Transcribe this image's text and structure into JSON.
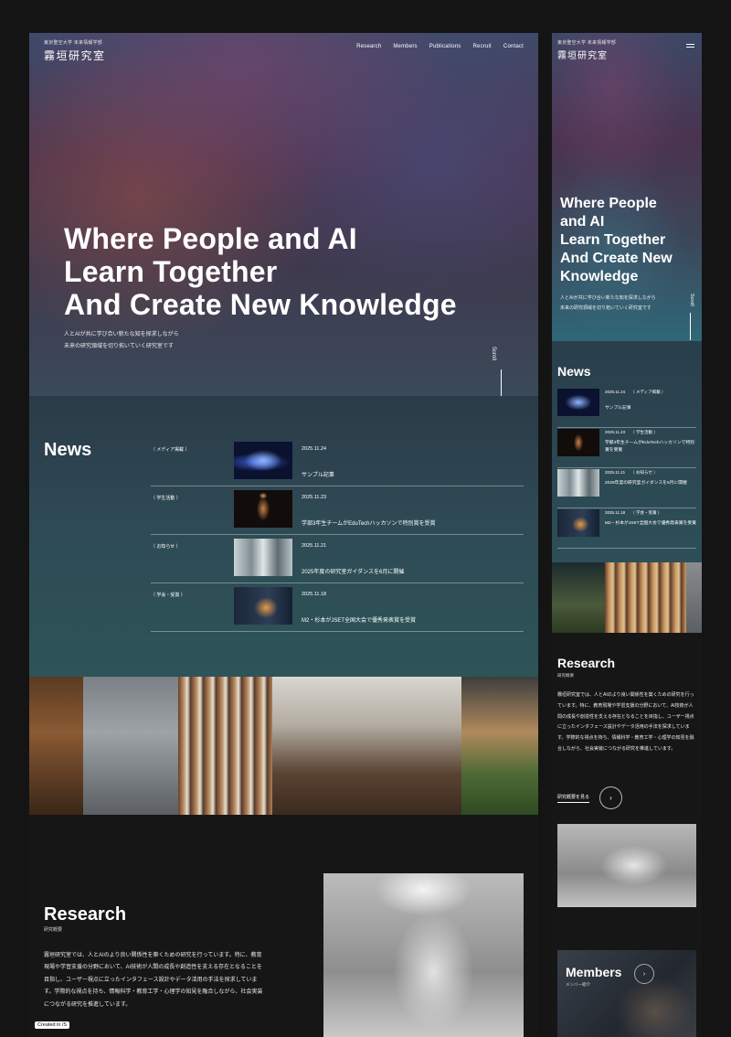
{
  "brand": {
    "university": "東京聖空大学 未来情報学部",
    "lab_name": "霧垣研究室"
  },
  "nav": {
    "items": [
      "Research",
      "Members",
      "Publications",
      "Recruit",
      "Contact"
    ]
  },
  "hero": {
    "title_desktop": "Where People and AI\nLearn Together\nAnd Create New Knowledge",
    "title_mobile": "Where People\nand AI\nLearn Together\nAnd Create New\nKnowledge",
    "subtitle": "人とAIが共に学び合い新たな知を探求しながら\n未来の研究領域を切り拓いていく研究室です",
    "scroll_label": "Scroll"
  },
  "news": {
    "heading": "News",
    "items": [
      {
        "category": "（ メディア掲載 ）",
        "date": "2025.11.24",
        "title": "サンプル記事",
        "thumb": "neural-network-image"
      },
      {
        "category": "（ 学生活動 ）",
        "date": "2025.11.23",
        "title": "学部3年生チームがEduTechハッカソンで特別賞を受賞",
        "title_mobile": "学部3年生チームがEduTechハッカソンで特別賞を受賞",
        "thumb": "android-figure-image"
      },
      {
        "category": "（ お知らせ ）",
        "date": "2025.11.21",
        "title": "2025年度の研究室ガイダンスを6月に開催",
        "thumb": "meeting-room-image"
      },
      {
        "category": "（ 学会・受賞 ）",
        "date": "2025.11.18",
        "title": "M2・杉本がJSET全国大会で優秀発表賞を受賞",
        "thumb": "laptop-discussion-image"
      }
    ],
    "mobile_categories": [
      "（ メディア掲載 ）",
      "（ 学生活動 ）",
      "（ お知らせ ）",
      "（ 学会・受賞 ）"
    ]
  },
  "research": {
    "heading": "Research",
    "subheading": "研究概要",
    "body": "霧垣研究室では、人とAIのより良い関係性を築くための研究を行っています。特に、教育現場や学習支援の分野において、AI技術が人間の成長や創造性を支える存在となることを目指し、ユーザー視点に立ったインタフェース設計やデータ活用の手法を探求しています。学際的な視点を持ち、情報科学・教育工学・心理学の知見を融合しながら、社会実装につながる研究を推進しています。",
    "more_label": "研究概要を見る",
    "more_icon": "chevron-right-icon"
  },
  "members": {
    "heading": "Members",
    "subheading": "メンバー紹介"
  },
  "badge": "Created in /S",
  "colors": {
    "background": "#141414",
    "news_teal": "#2d5458",
    "hero_purple": "#4d3550"
  }
}
